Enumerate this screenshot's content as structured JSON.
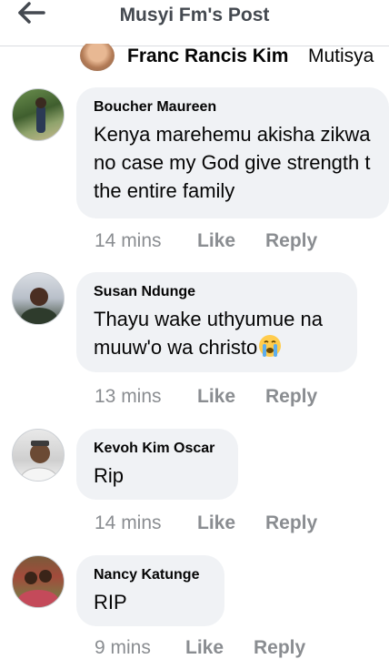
{
  "header": {
    "title": "Musyi Fm's Post",
    "back_icon": "arrow-left-icon"
  },
  "reply_row": {
    "name": "Franc Rancis Kim",
    "name_continued": "Mutisya"
  },
  "comments": [
    {
      "author": "Boucher Maureen",
      "text": "Kenya marehemu akisha zikwa\nno case my God give strength t\nthe entire family",
      "time": "14 mins",
      "like": "Like",
      "reply": "Reply"
    },
    {
      "author": "Susan Ndunge",
      "text": "Thayu wake uthyumue na\nmuuw'o wa christo",
      "time": "13 mins",
      "like": "Like",
      "reply": "Reply",
      "emoji": "crying-face"
    },
    {
      "author": "Kevoh Kim Oscar",
      "text": "Rip",
      "time": "14 mins",
      "like": "Like",
      "reply": "Reply"
    },
    {
      "author": "Nancy Katunge",
      "text": "RIP",
      "time": "9 mins",
      "like": "Like",
      "reply": "Reply"
    }
  ],
  "colors": {
    "bubble": "#f0f2f5",
    "meta": "#8a8d91",
    "text": "#050505",
    "header_text": "#444950"
  }
}
